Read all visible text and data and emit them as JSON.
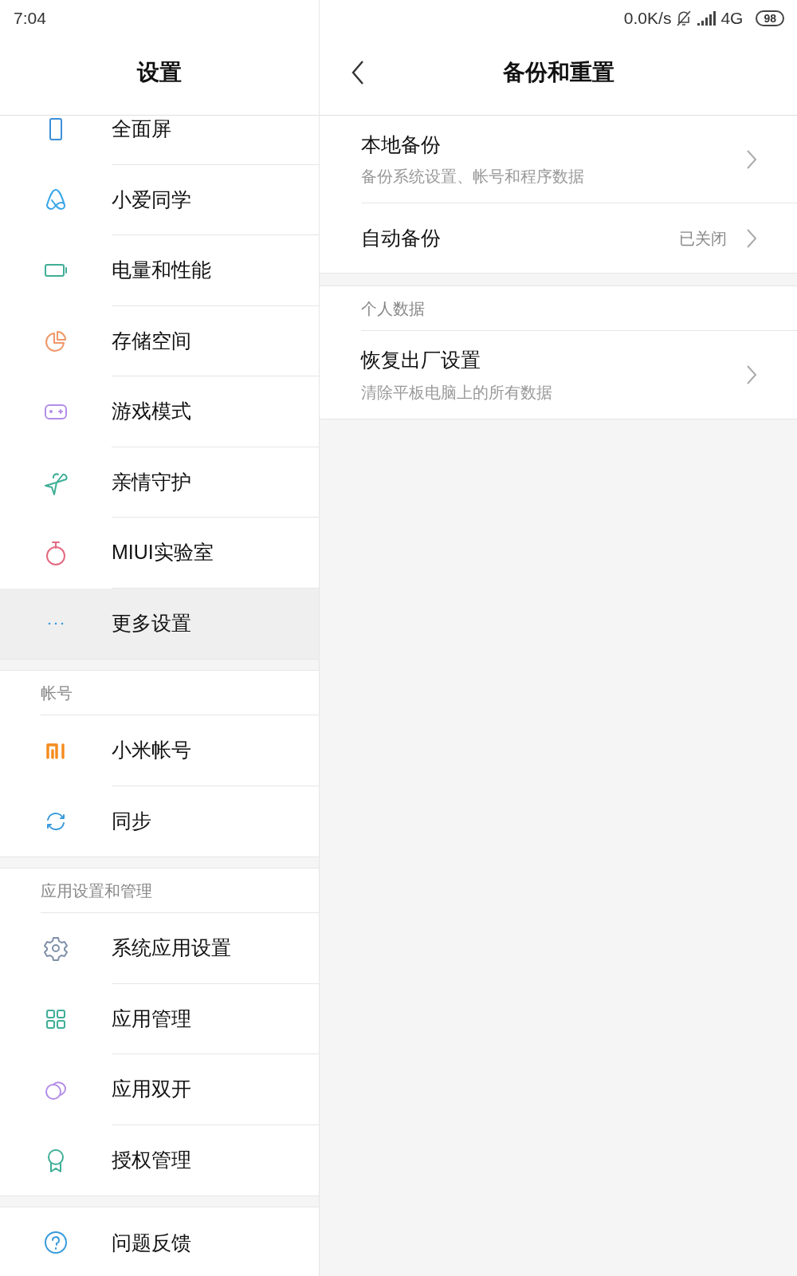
{
  "status_bar": {
    "time": "7:04",
    "net_speed": "0.0K/s",
    "network": "4G",
    "battery": "98"
  },
  "settings": {
    "title": "设置",
    "groups": [
      {
        "items": [
          {
            "label": "全面屏",
            "kind": "screen",
            "selected": false
          },
          {
            "label": "小爱同学",
            "kind": "assistant",
            "selected": false
          },
          {
            "label": "电量和性能",
            "kind": "battery",
            "selected": false
          },
          {
            "label": "存储空间",
            "kind": "pie",
            "selected": false
          },
          {
            "label": "游戏模式",
            "kind": "gamepad",
            "selected": false
          },
          {
            "label": "亲情守护",
            "kind": "plane",
            "selected": false
          },
          {
            "label": "MIUI实验室",
            "kind": "flask",
            "selected": false
          },
          {
            "label": "更多设置",
            "kind": "dots",
            "selected": true
          }
        ]
      },
      {
        "header": "帐号",
        "items": [
          {
            "label": "小米帐号",
            "kind": "mi",
            "selected": false
          },
          {
            "label": "同步",
            "kind": "sync",
            "selected": false
          }
        ]
      },
      {
        "header": "应用设置和管理",
        "items": [
          {
            "label": "系统应用设置",
            "kind": "gear",
            "selected": false
          },
          {
            "label": "应用管理",
            "kind": "grid",
            "selected": false
          },
          {
            "label": "应用双开",
            "kind": "circles",
            "selected": false
          },
          {
            "label": "授权管理",
            "kind": "ribbon",
            "selected": false
          }
        ]
      },
      {
        "items": [
          {
            "label": "问题反馈",
            "kind": "help",
            "selected": false
          }
        ]
      }
    ]
  },
  "detail": {
    "title": "备份和重置",
    "sections": [
      {
        "items": [
          {
            "title": "本地备份",
            "subtitle": "备份系统设置、帐号和程序数据"
          },
          {
            "title": "自动备份",
            "value": "已关闭"
          }
        ]
      },
      {
        "header": "个人数据",
        "items": [
          {
            "title": "恢复出厂设置",
            "subtitle": "清除平板电脑上的所有数据"
          }
        ]
      }
    ]
  }
}
